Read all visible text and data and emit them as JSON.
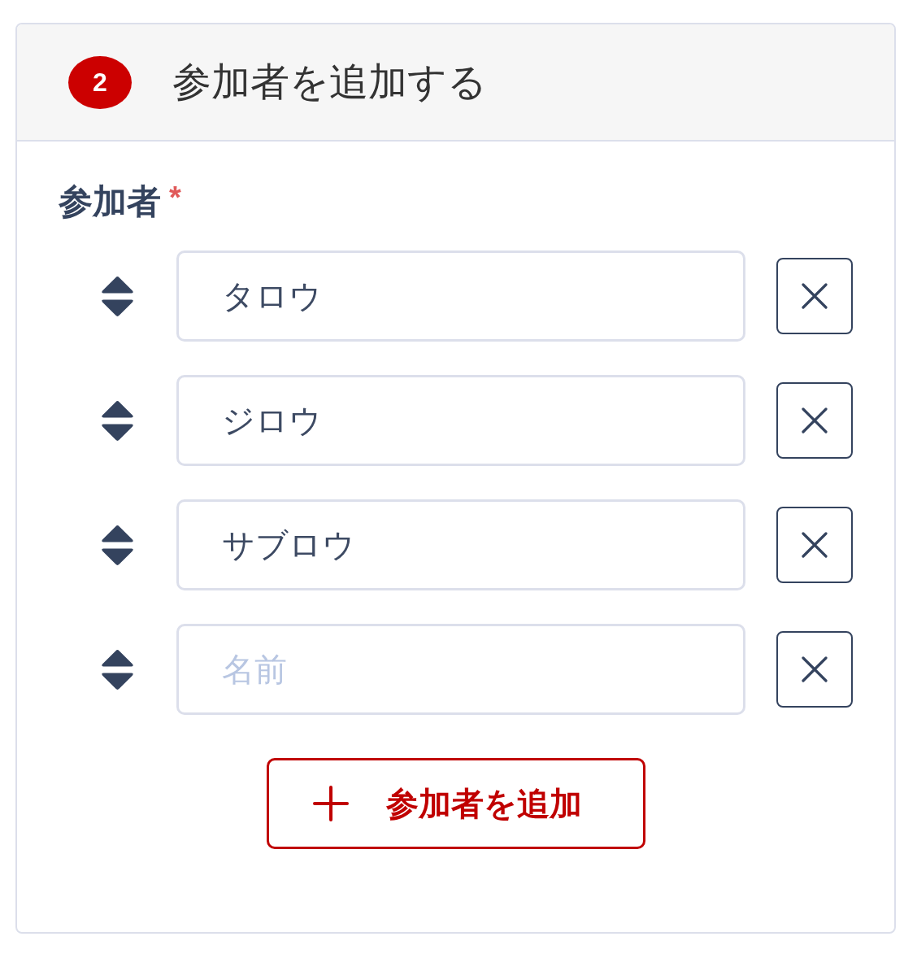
{
  "step": {
    "number": "2",
    "title": "参加者を追加する"
  },
  "field": {
    "label": "参加者",
    "required_mark": "*"
  },
  "participants": [
    {
      "value": "タロウ"
    },
    {
      "value": "ジロウ"
    },
    {
      "value": "サブロウ"
    },
    {
      "placeholder": "名前"
    }
  ],
  "add_button": {
    "label": "参加者を追加"
  }
}
